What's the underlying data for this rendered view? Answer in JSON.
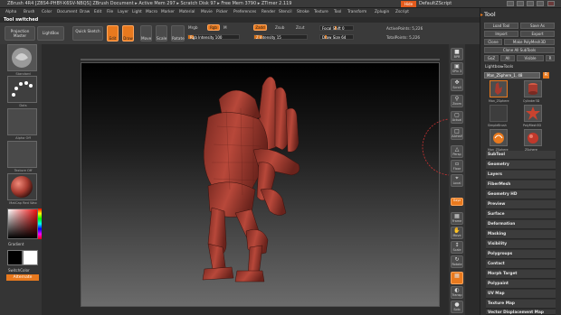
{
  "titlebar": {
    "text": "ZBrush 4R4 [ZBS4-PHBY-K6SV-NBQS]   ZBrush Document   ▸ Active Mem 297 ▸ Scratch Disk 97 ▸ Free Mem 3790 ▸ ZTimer 2.119",
    "hide": "Hide",
    "default_script": "DefaultZScript"
  },
  "menus": [
    "Alpha",
    "Brush",
    "Color",
    "Document",
    "Draw",
    "Edit",
    "File",
    "Layer",
    "Light",
    "Macro",
    "Marker",
    "Material",
    "Movie",
    "Picker",
    "Preferences",
    "Render",
    "Stencil",
    "Stroke",
    "Texture",
    "Tool",
    "Transform",
    "Zplugin",
    "Zscript"
  ],
  "tool_switched": "Tool switched",
  "shelf": {
    "projection_master": "Projection Master",
    "lightbox": "LightBox",
    "quick_sketch": "Quick Sketch",
    "edit": "Edit",
    "draw": "Draw",
    "move": "Move",
    "scale": "Scale",
    "rotate": "Rotate",
    "mrgb": "Mrgb",
    "rgb": "Rgb",
    "m": "M",
    "zadd": "Zadd",
    "zsub": "Zsub",
    "zcut": "Zcut",
    "rgb_intensity": "Rgb Intensity 100",
    "z_intensity": "Z Intensity 15",
    "focal_shift": "Focal Shift 0",
    "draw_size": "Draw Size 64",
    "active_points": "ActivePoints: 5,226",
    "total_points": "TotalPoints: 5,226"
  },
  "left": {
    "thumb_labels": [
      "Standard",
      "Dots",
      "",
      "Alpha Off",
      "Texture Off",
      "MatCap Red Wax"
    ],
    "gradient": "Gradient",
    "switch_color": "SwitchColor",
    "alternate": "Alternate"
  },
  "right_shelf": [
    "BPR",
    "SPix 3",
    "Scroll",
    "Zoom",
    "Actual",
    "AAHalf",
    "Persp",
    "Floor",
    "Local",
    "Gxyz",
    "Frame",
    "Move",
    "Scale",
    "Rotate",
    "Line Fill PolyF",
    "Transp",
    "Ghost",
    "Solo",
    "Xpose"
  ],
  "panel": {
    "title": "Tool",
    "load_tool": "Load Tool",
    "save_as": "Save As",
    "import": "Import",
    "export": "Export",
    "clone": "Clone",
    "make_polymesh": "Make PolyMesh3D",
    "clone_all_subtools": "Clone All SubTools",
    "goz": "GoZ",
    "all": "All",
    "visible": "Visible",
    "r": "R",
    "lightbox_tools": "Lightbox▸Tools",
    "current_tool": "Man_ZSphere_1. 48",
    "tools": [
      "Man_ZSphere",
      "Cylinder3D",
      "",
      "PolyMesh3D",
      "SimpleBrush",
      "ZSphere",
      "Man_ZSphere",
      "ZSphere_1"
    ],
    "subpalettes": [
      "SubTool",
      "Geometry",
      "Layers",
      "FiberMesh",
      "Geometry HD",
      "Preview",
      "Surface",
      "Deformation",
      "Masking",
      "Visibility",
      "Polygroups",
      "Contact",
      "Morph Target",
      "Polypaint",
      "UV Map",
      "Texture Map",
      "Vector Displacement Map"
    ]
  },
  "colors": {
    "accent_orange": "#e8791e",
    "model_red": "#a63a2f",
    "selection_ring": "#c83232"
  }
}
